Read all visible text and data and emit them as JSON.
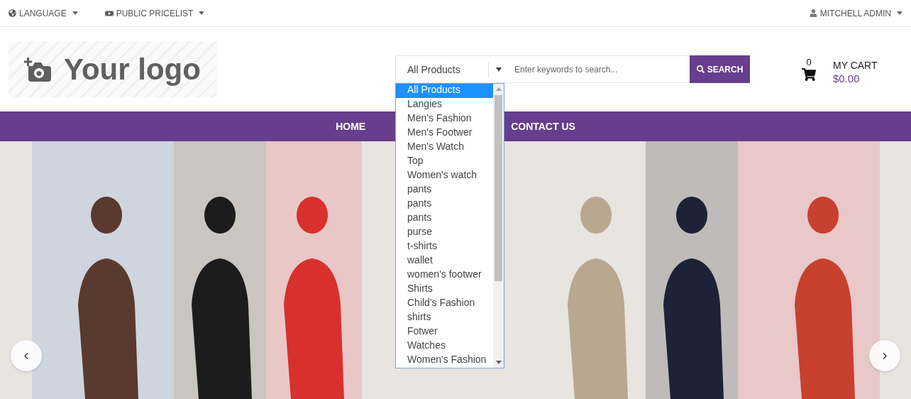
{
  "top_bar": {
    "left_menus": [
      {
        "label": "LANGUAGE",
        "kind": "globe"
      },
      {
        "label": "PUBLIC PRICELIST",
        "kind": "money"
      }
    ],
    "user_menu": {
      "label": "MITCHELL ADMIN"
    }
  },
  "logo": {
    "text": "Your logo"
  },
  "search": {
    "category": "All Products",
    "placeholder": "Enter keywords to search...",
    "button": "SEARCH",
    "category_options": [
      {
        "label": "All Products",
        "selected": true
      },
      {
        "label": "Langies",
        "selected": false
      },
      {
        "label": "Men's Fashion",
        "selected": false
      },
      {
        "label": "Men's Footwer",
        "selected": false
      },
      {
        "label": "Men's Watch",
        "selected": false
      },
      {
        "label": "Top",
        "selected": false
      },
      {
        "label": "Women's watch",
        "selected": false
      },
      {
        "label": "pants",
        "selected": false
      },
      {
        "label": "pants",
        "selected": false
      },
      {
        "label": "pants",
        "selected": false
      },
      {
        "label": "purse",
        "selected": false
      },
      {
        "label": "t-shirts",
        "selected": false
      },
      {
        "label": "wallet",
        "selected": false
      },
      {
        "label": "women's footwer",
        "selected": false
      },
      {
        "label": "Shirts",
        "selected": false
      },
      {
        "label": "Child's Fashion",
        "selected": false
      },
      {
        "label": "shirts",
        "selected": false
      },
      {
        "label": "Fotwer",
        "selected": false
      },
      {
        "label": "Watches",
        "selected": false
      },
      {
        "label": "Women's Fashion",
        "selected": false
      }
    ]
  },
  "cart": {
    "count": "0",
    "label": "MY CART",
    "total": "$0.00"
  },
  "nav": [
    {
      "label": "HOME"
    },
    {
      "label": "CONTACT US"
    }
  ]
}
